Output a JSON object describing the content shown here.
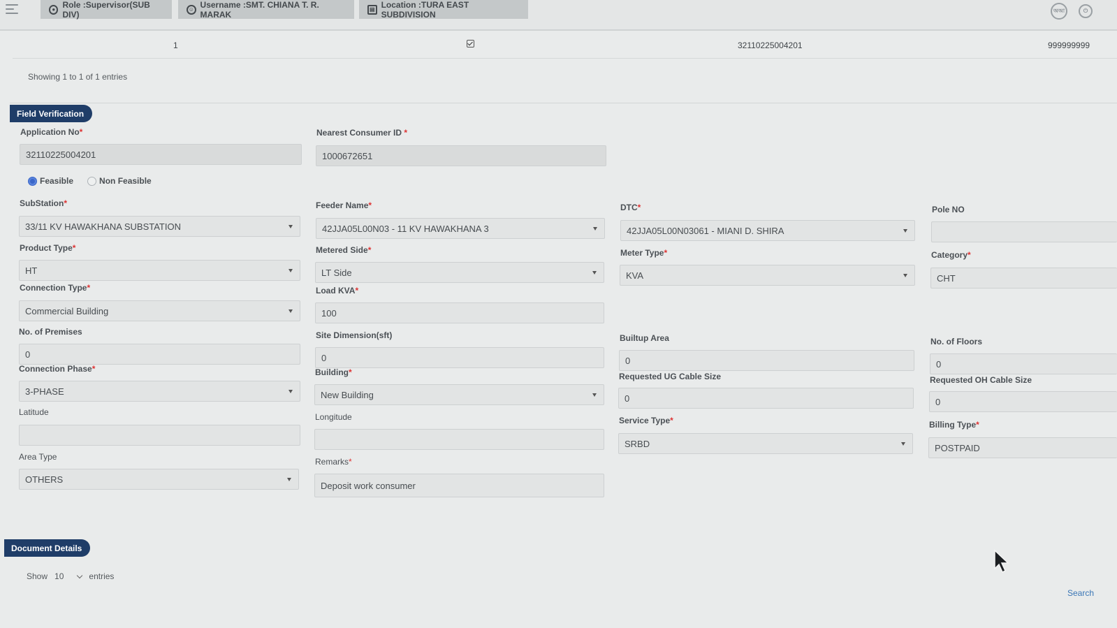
{
  "header": {
    "role": "Role :Supervisor(SUB DIV)",
    "username": "Username :SMT. CHIANA T. R. MARAK",
    "location": "Location :TURA EAST SUBDIVISION"
  },
  "table_row": {
    "serial": "1",
    "application_no": "32110225004201",
    "trailing_value": "999999999"
  },
  "table_info": "Showing 1 to 1 of 1 entries",
  "field_verification": {
    "section_title": "Field Verification",
    "application_no": {
      "label": "Application No",
      "value": "32110225004201"
    },
    "nearest_consumer_id": {
      "label": "Nearest Consumer ID",
      "value": "1000672651"
    },
    "feasibility": {
      "options": [
        "Feasible",
        "Non Feasible"
      ],
      "selected": "Feasible"
    },
    "substation": {
      "label": "SubStation",
      "value": "33/11 KV HAWAKHANA SUBSTATION"
    },
    "feeder_name": {
      "label": "Feeder Name",
      "value": "42JJA05L00N03 - 11 KV HAWAKHANA 3"
    },
    "dtc": {
      "label": "DTC",
      "value": "42JJA05L00N03061 - MIANI D. SHIRA"
    },
    "pole_no": {
      "label": "Pole NO",
      "value": ""
    },
    "product_type": {
      "label": "Product Type",
      "value": "HT"
    },
    "metered_side": {
      "label": "Metered Side",
      "value": "LT Side"
    },
    "meter_type": {
      "label": "Meter Type",
      "value": "KVA"
    },
    "category": {
      "label": "Category",
      "value": "CHT"
    },
    "connection_type": {
      "label": "Connection Type",
      "value": "Commercial Building"
    },
    "load_kva": {
      "label": "Load KVA",
      "value": "100"
    },
    "no_of_premises": {
      "label": "No. of Premises",
      "value": "0"
    },
    "site_dimension": {
      "label": "Site Dimension(sft)",
      "value": "0"
    },
    "builtup_area": {
      "label": "Builtup Area",
      "value": "0"
    },
    "no_of_floors": {
      "label": "No. of Floors",
      "value": "0"
    },
    "connection_phase": {
      "label": "Connection Phase",
      "value": "3-PHASE"
    },
    "building": {
      "label": "Building",
      "value": "New Building"
    },
    "req_ug_cable": {
      "label": "Requested UG Cable Size",
      "value": "0"
    },
    "req_oh_cable": {
      "label": "Requested OH Cable Size",
      "value": "0"
    },
    "latitude": {
      "label": "Latitude",
      "value": ""
    },
    "longitude": {
      "label": "Longitude",
      "value": ""
    },
    "service_type": {
      "label": "Service Type",
      "value": "SRBD"
    },
    "billing_type": {
      "label": "Billing Type",
      "value": "POSTPAID"
    },
    "area_type": {
      "label": "Area Type",
      "value": "OTHERS"
    },
    "remarks": {
      "label": "Remarks",
      "value": "Deposit work consumer"
    }
  },
  "document_details": {
    "section_title": "Document Details",
    "show_label": "Show",
    "page_size": "10",
    "entries_label": "entries",
    "search_label": "Search"
  },
  "colors": {
    "section_pill": "#1f3d68",
    "required": "#dd3333",
    "radio_selected": "#3a66c9"
  }
}
